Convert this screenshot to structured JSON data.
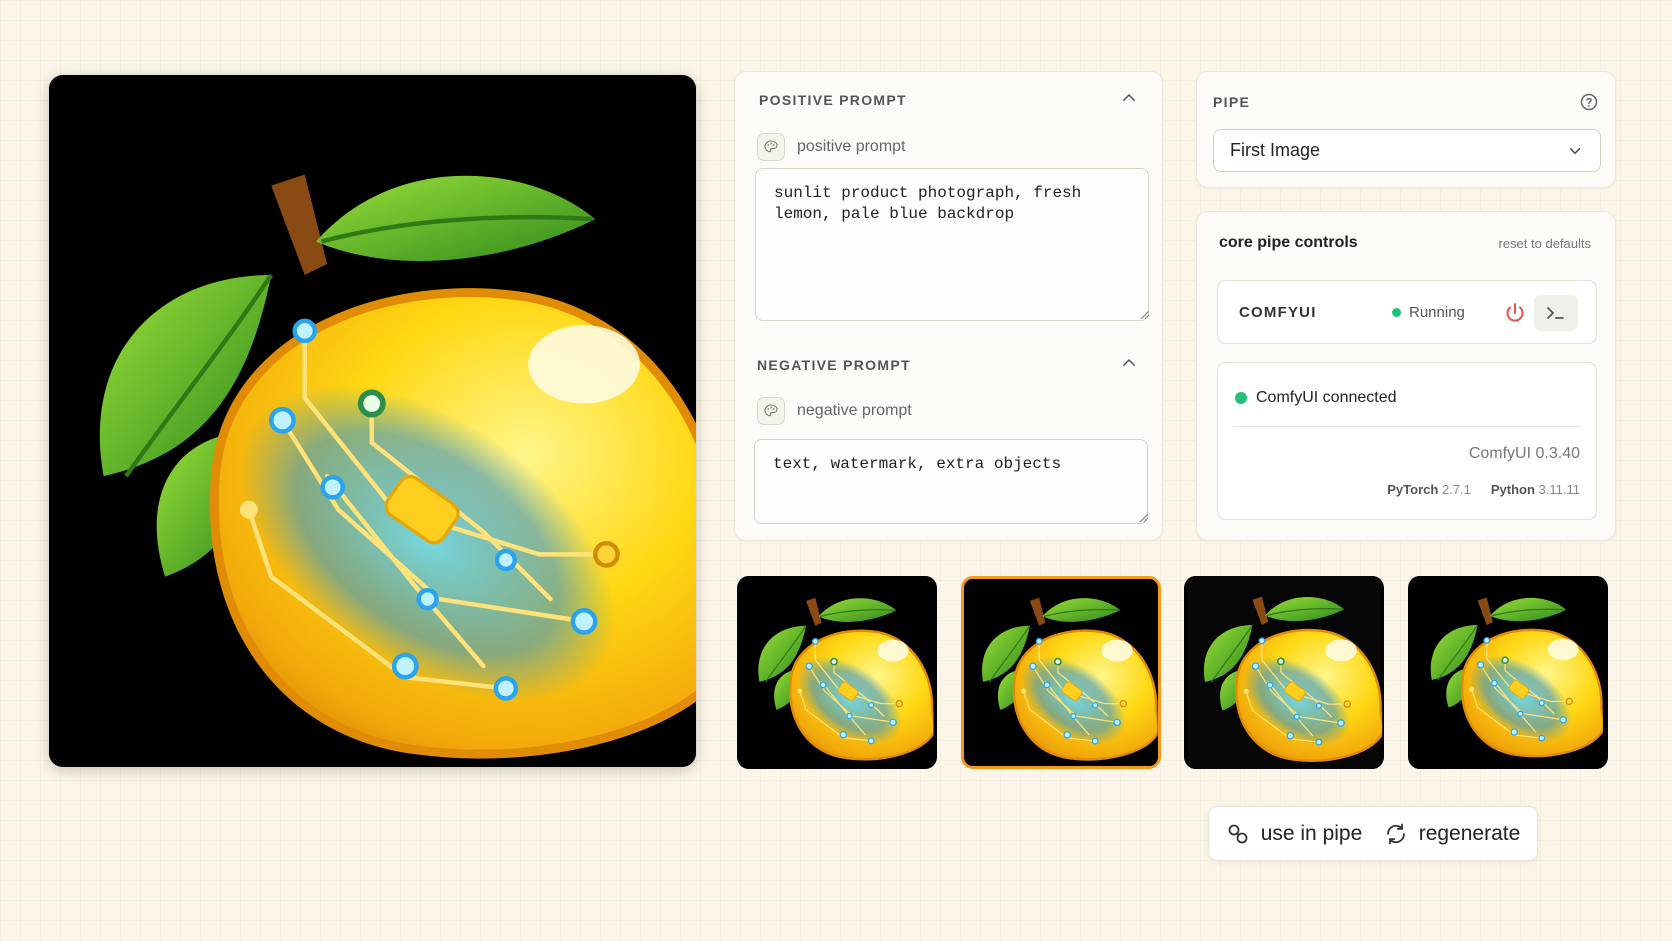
{
  "prompts": {
    "positive_title": "POSITIVE PROMPT",
    "positive_label": "positive prompt",
    "positive_value": "sunlit product photograph, fresh\nlemon, pale blue backdrop",
    "negative_title": "NEGATIVE PROMPT",
    "negative_label": "negative prompt",
    "negative_value": "text, watermark, extra objects"
  },
  "pipe": {
    "title": "PIPE",
    "selected": "First Image"
  },
  "core": {
    "title": "core pipe controls",
    "reset": "reset to defaults",
    "service_name": "COMFYUI",
    "service_status": "Running",
    "connection": "ComfyUI connected",
    "version_name": "ComfyUI",
    "version": "0.3.40",
    "pytorch_label": "PyTorch",
    "pytorch_version": "2.7.1",
    "python_label": "Python",
    "python_version": "3.11.11"
  },
  "actions": {
    "use_in_pipe": "use in pipe",
    "regenerate": "regenerate"
  },
  "thumbnails": {
    "count": 4,
    "selected_index": 1
  },
  "colors": {
    "accent_selected": "#f39a1e",
    "status_green": "#22c07a",
    "power_red": "#e8524a"
  }
}
